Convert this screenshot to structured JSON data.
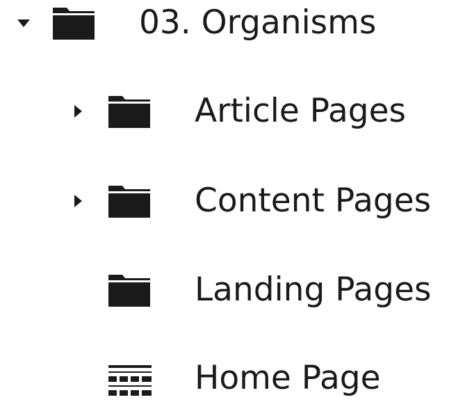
{
  "tree": {
    "root": {
      "label": "03. Organisms",
      "expanded": true,
      "icon": "folder-icon",
      "toggle_icon": "caret-down-icon"
    },
    "children": [
      {
        "label": "Article Pages",
        "icon": "folder-icon",
        "toggle_icon": "caret-right-icon",
        "expanded": false
      },
      {
        "label": "Content Pages",
        "icon": "folder-icon",
        "toggle_icon": "caret-right-icon",
        "expanded": false
      },
      {
        "label": "Landing Pages",
        "icon": "folder-icon"
      },
      {
        "label": "Home Page",
        "icon": "layout-grid-icon"
      }
    ]
  },
  "colors": {
    "text": "#1a1a1a",
    "icon": "#1a1a1a",
    "background": "#ffffff"
  }
}
